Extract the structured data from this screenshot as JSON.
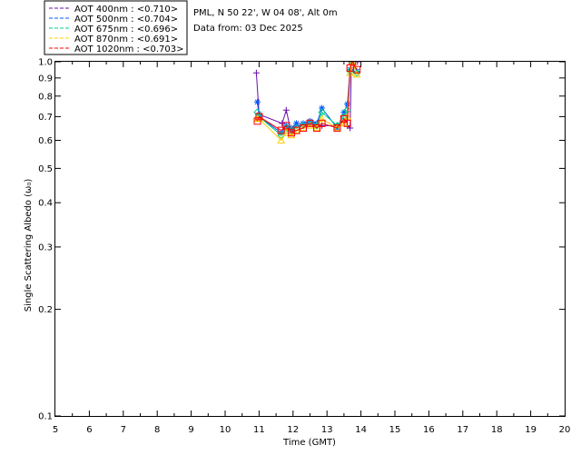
{
  "header": {
    "site_line": "PML, N 50 22', W 04 08', Alt 0m",
    "date_line": "Data from: 03 Dec 2025"
  },
  "chart_data": {
    "type": "line",
    "xlabel": "Time (GMT)",
    "ylabel": "Single Scattering Albedo (ω₀)",
    "xlim": [
      5,
      20
    ],
    "ylim": [
      0.1,
      1.0
    ],
    "yscale": "log",
    "x_ticks": [
      "5",
      "6",
      "7",
      "8",
      "9",
      "10",
      "11",
      "12",
      "13",
      "14",
      "15",
      "16",
      "17",
      "18",
      "19",
      "20"
    ],
    "y_ticks": [
      "0.1",
      "0.2",
      "0.3",
      "0.4",
      "0.5",
      "0.6",
      "0.7",
      "0.8",
      "0.9",
      "1.0"
    ],
    "legend_position": "top-left-outside",
    "grid": false,
    "series": [
      {
        "name": "AOT  400nm : <0.710>",
        "color": "#6a0dad",
        "marker": "plus",
        "points": [
          [
            10.92,
            0.93
          ],
          [
            11.0,
            0.71
          ],
          [
            11.68,
            0.67
          ],
          [
            11.8,
            0.73
          ],
          [
            11.95,
            0.63
          ],
          [
            12.1,
            0.66
          ],
          [
            12.3,
            0.66
          ],
          [
            12.5,
            0.67
          ],
          [
            12.7,
            0.66
          ],
          [
            12.85,
            0.66
          ],
          [
            13.3,
            0.66
          ],
          [
            13.5,
            0.68
          ],
          [
            13.6,
            0.66
          ],
          [
            13.68,
            0.65
          ],
          [
            13.72,
            1.0
          ],
          [
            13.8,
            1.0
          ],
          [
            13.9,
            1.0
          ]
        ]
      },
      {
        "name": "AOT  500nm : <0.704>",
        "color": "#0055ff",
        "marker": "asterisk",
        "points": [
          [
            10.95,
            0.77
          ],
          [
            11.0,
            0.7
          ],
          [
            11.65,
            0.63
          ],
          [
            11.8,
            0.66
          ],
          [
            11.95,
            0.65
          ],
          [
            12.1,
            0.67
          ],
          [
            12.3,
            0.67
          ],
          [
            12.5,
            0.68
          ],
          [
            12.7,
            0.67
          ],
          [
            12.85,
            0.74
          ],
          [
            13.3,
            0.65
          ],
          [
            13.5,
            0.72
          ],
          [
            13.6,
            0.76
          ],
          [
            13.68,
            0.95
          ],
          [
            13.75,
            1.0
          ],
          [
            13.88,
            0.94
          ]
        ]
      },
      {
        "name": "AOT  675nm : <0.696>",
        "color": "#00cc88",
        "marker": "diamond",
        "points": [
          [
            10.95,
            0.72
          ],
          [
            11.0,
            0.7
          ],
          [
            11.65,
            0.62
          ],
          [
            11.8,
            0.65
          ],
          [
            11.95,
            0.64
          ],
          [
            12.1,
            0.65
          ],
          [
            12.3,
            0.66
          ],
          [
            12.5,
            0.67
          ],
          [
            12.7,
            0.66
          ],
          [
            12.85,
            0.72
          ],
          [
            13.3,
            0.66
          ],
          [
            13.5,
            0.7
          ],
          [
            13.6,
            0.73
          ],
          [
            13.68,
            0.94
          ],
          [
            13.75,
            1.0
          ],
          [
            13.88,
            0.93
          ]
        ]
      },
      {
        "name": "AOT  870nm : <0.691>",
        "color": "#ffcc00",
        "marker": "triangle",
        "points": [
          [
            10.95,
            0.69
          ],
          [
            11.0,
            0.69
          ],
          [
            11.65,
            0.6
          ],
          [
            11.8,
            0.63
          ],
          [
            11.95,
            0.62
          ],
          [
            12.1,
            0.64
          ],
          [
            12.3,
            0.65
          ],
          [
            12.5,
            0.66
          ],
          [
            12.7,
            0.65
          ],
          [
            12.85,
            0.69
          ],
          [
            13.3,
            0.65
          ],
          [
            13.5,
            0.67
          ],
          [
            13.6,
            0.7
          ],
          [
            13.68,
            0.93
          ],
          [
            13.75,
            1.0
          ],
          [
            13.88,
            0.92
          ]
        ]
      },
      {
        "name": "AOT 1020nm : <0.703>",
        "color": "#ff0000",
        "marker": "square",
        "points": [
          [
            10.95,
            0.68
          ],
          [
            11.0,
            0.7
          ],
          [
            11.65,
            0.64
          ],
          [
            11.8,
            0.66
          ],
          [
            11.95,
            0.63
          ],
          [
            12.1,
            0.64
          ],
          [
            12.3,
            0.65
          ],
          [
            12.5,
            0.67
          ],
          [
            12.7,
            0.65
          ],
          [
            12.85,
            0.67
          ],
          [
            13.3,
            0.65
          ],
          [
            13.5,
            0.69
          ],
          [
            13.6,
            0.67
          ],
          [
            13.68,
            0.96
          ],
          [
            13.75,
            1.0
          ],
          [
            13.88,
            0.95
          ]
        ]
      }
    ]
  }
}
